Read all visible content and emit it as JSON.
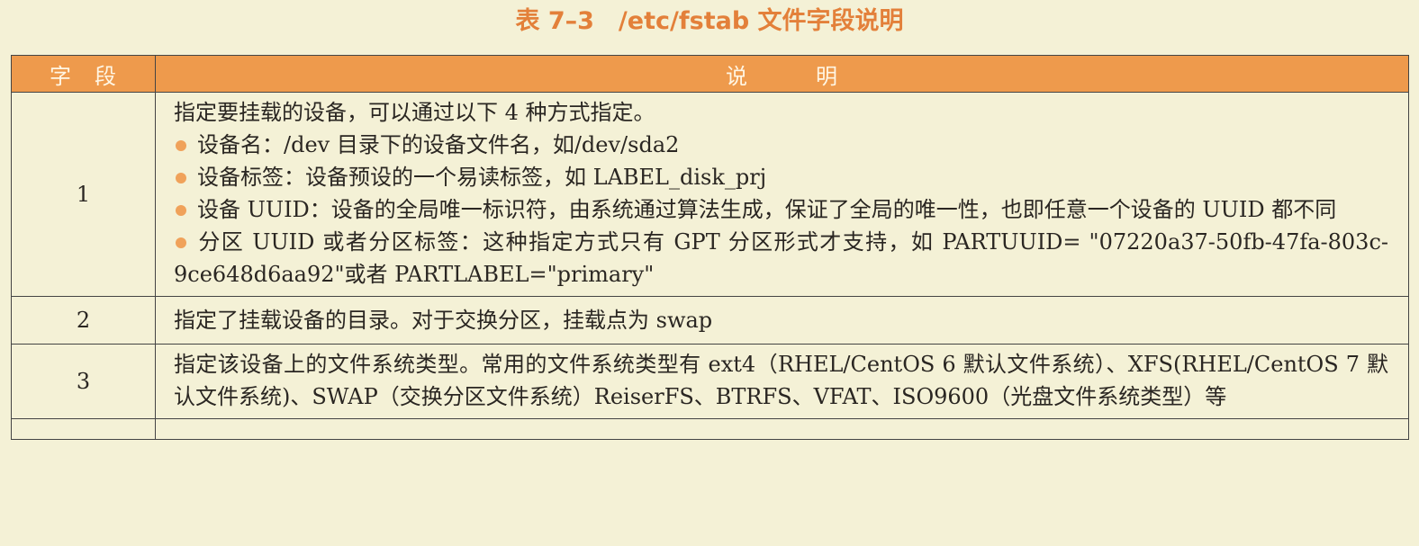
{
  "caption": "表 7–3　/etc/fstab 文件字段说明",
  "table": {
    "headers": [
      "字　段",
      "说　　　明"
    ],
    "rows": [
      {
        "field": "1",
        "intro": "指定要挂载的设备，可以通过以下 4 种方式指定。",
        "bullets": [
          "设备名：/dev 目录下的设备文件名，如/dev/sda2",
          "设备标签：设备预设的一个易读标签，如 LABEL_disk_prj",
          "设备 UUID：设备的全局唯一标识符，由系统通过算法生成，保证了全局的唯一性，也即任意一个设备的 UUID 都不同",
          "分区 UUID 或者分区标签：这种指定方式只有 GPT 分区形式才支持，如 PARTUUID= \"07220a37-50fb-47fa-803c-9ce648d6aa92\"或者 PARTLABEL=\"primary\""
        ]
      },
      {
        "field": "2",
        "description": "指定了挂载设备的目录。对于交换分区，挂载点为 swap"
      },
      {
        "field": "3",
        "description": "指定该设备上的文件系统类型。常用的文件系统类型有 ext4（RHEL/CentOS 6 默认文件系统）、XFS(RHEL/CentOS 7 默认文件系统)、SWAP（交换分区文件系统）ReiserFS、BTRFS、VFAT、ISO9600（光盘文件系统类型）等"
      }
    ]
  },
  "colors": {
    "caption": "#e3803a",
    "header_bg": "#ee9a4c",
    "header_text": "#fff6e4",
    "page_bg": "#f4f1d6",
    "bullet": "#f0a25a",
    "border": "#444444"
  }
}
